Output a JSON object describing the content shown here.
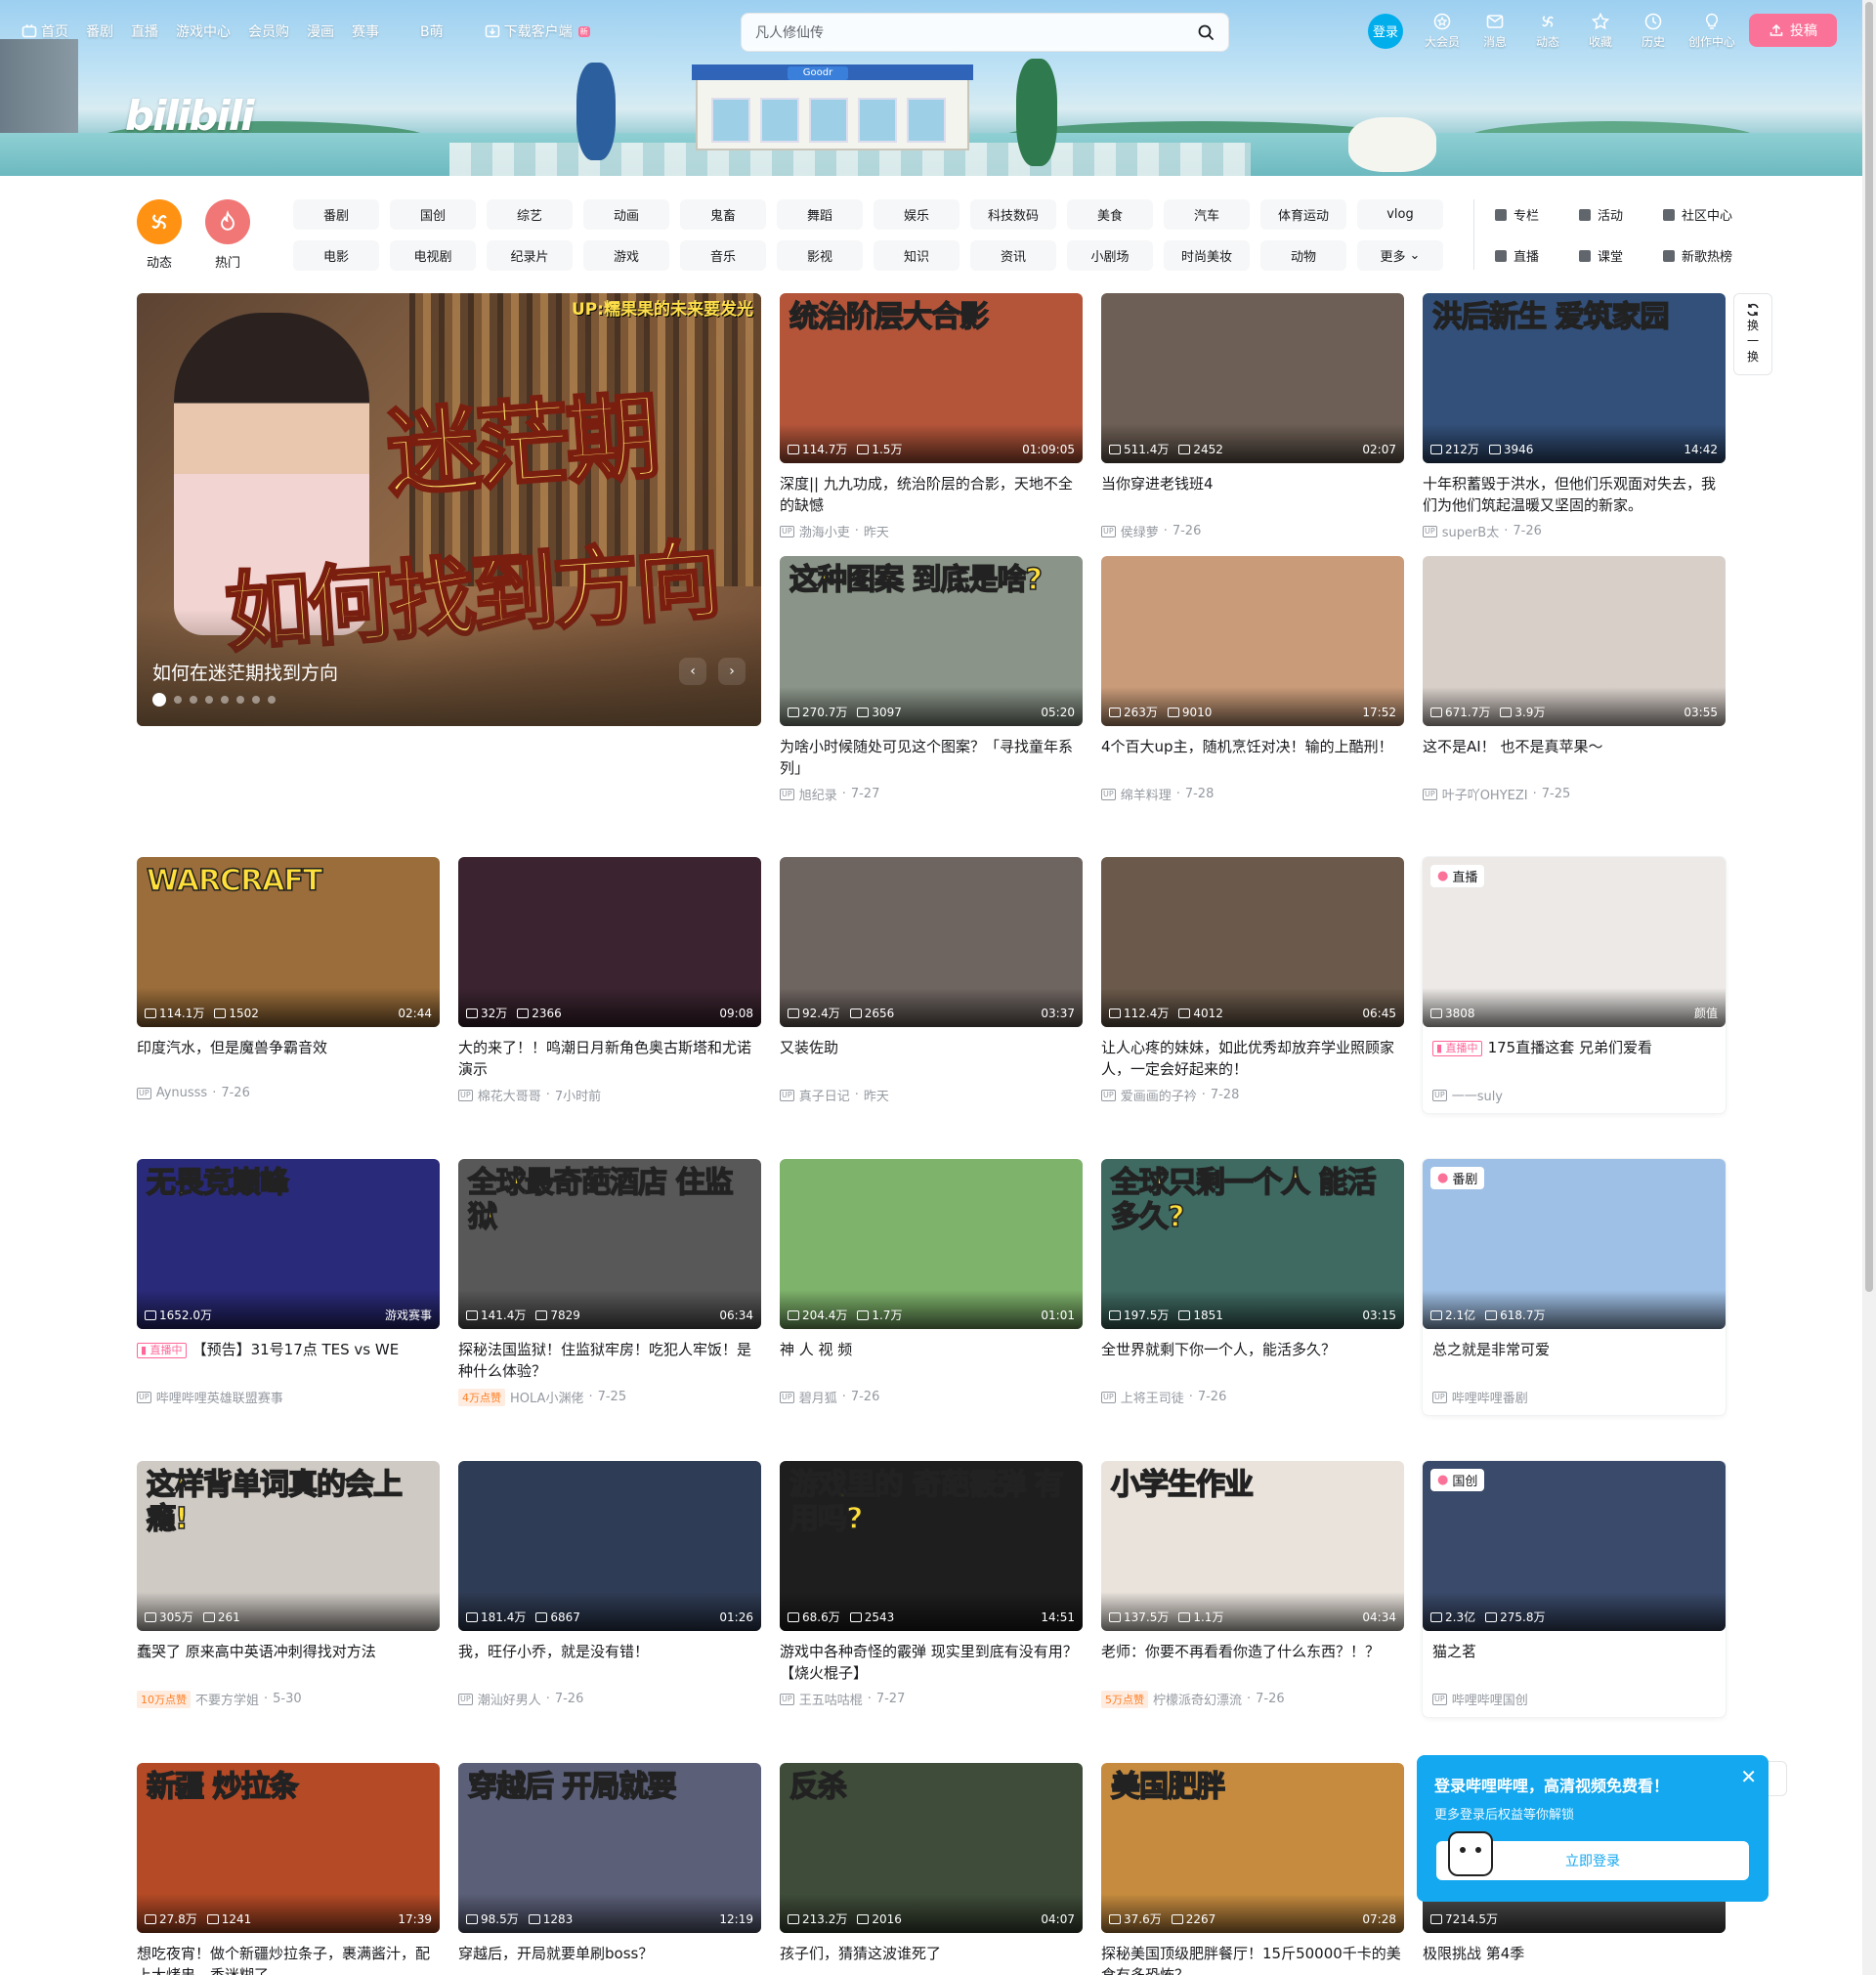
{
  "nav": {
    "left": [
      {
        "label": "首页",
        "icon": "tv-icon"
      },
      {
        "label": "番剧"
      },
      {
        "label": "直播"
      },
      {
        "label": "游戏中心"
      },
      {
        "label": "会员购"
      },
      {
        "label": "漫画"
      },
      {
        "label": "赛事"
      },
      {
        "label": "B萌"
      },
      {
        "label": "下载客户端",
        "icon": "download-icon",
        "badge": "新"
      }
    ],
    "search_placeholder": "凡人修仙传",
    "login": "登录",
    "right": [
      {
        "label": "大会员",
        "icon": "vip-icon"
      },
      {
        "label": "消息",
        "icon": "message-icon"
      },
      {
        "label": "动态",
        "icon": "wind-icon"
      },
      {
        "label": "收藏",
        "icon": "star-icon"
      },
      {
        "label": "历史",
        "icon": "clock-icon"
      },
      {
        "label": "创作中心",
        "icon": "bulb-icon"
      }
    ],
    "upload": "投稿"
  },
  "categories": {
    "big": [
      {
        "label": "动态",
        "color": "#ff9212"
      },
      {
        "label": "热门",
        "color": "#f07775"
      }
    ],
    "row1": [
      "番剧",
      "国创",
      "综艺",
      "动画",
      "鬼畜",
      "舞蹈",
      "娱乐",
      "科技数码",
      "美食",
      "汽车",
      "体育运动",
      "vlog"
    ],
    "row2": [
      "电影",
      "电视剧",
      "纪录片",
      "游戏",
      "音乐",
      "影视",
      "知识",
      "资讯",
      "小剧场",
      "时尚美妆",
      "动物",
      "更多"
    ],
    "side": [
      "专栏",
      "活动",
      "社区中心",
      "直播",
      "课堂",
      "新歌热榜"
    ]
  },
  "carousel": {
    "tag": "UP:糯果果的未来要发光",
    "text1": "迷茫期",
    "text2": "如何找到方向",
    "caption": "如何在迷茫期找到方向",
    "dots": 8
  },
  "refresh": {
    "label1": "换",
    "label2": "一",
    "label3": "换"
  },
  "cards": [
    {
      "hl": "统治阶层大合影",
      "views": "114.7万",
      "danmaku": "1.5万",
      "dur": "01:09:05",
      "title": "深度|| 九九功成，统治阶层的合影，天地不全的缺憾",
      "author": "渤海小吏",
      "date": "昨天",
      "bg": "#b4553a"
    },
    {
      "hl": "",
      "views": "511.4万",
      "danmaku": "2452",
      "dur": "02:07",
      "title": "当你穿进老钱班4",
      "author": "侯绿萝",
      "date": "7-26",
      "bg": "#6d5f55"
    },
    {
      "hl": "洪后新生 爱筑家园",
      "views": "212万",
      "danmaku": "3946",
      "dur": "14:42",
      "title": "十年积蓄毁于洪水，但他们乐观面对失去，我们为他们筑起温暖又坚固的新家。",
      "author": "superB太",
      "date": "7-26",
      "bg": "#33507a"
    },
    {
      "hl": "这种图案 到底是啥?",
      "views": "270.7万",
      "danmaku": "3097",
      "dur": "05:20",
      "title": "为啥小时候随处可见这个图案？「寻找童年系列」",
      "author": "旭纪录",
      "date": "7-27",
      "bg": "#8a9488"
    },
    {
      "hl": "",
      "views": "263万",
      "danmaku": "9010",
      "dur": "17:52",
      "title": "4个百大up主，随机烹饪对决！输的上酷刑！",
      "author": "绵羊料理",
      "date": "7-28",
      "bg": "#c99b79"
    },
    {
      "hl": "",
      "views": "671.7万",
      "danmaku": "3.9万",
      "dur": "03:55",
      "title": "这不是AI！ 也不是真苹果～",
      "author": "叶子吖OHYEZI",
      "date": "7-25",
      "bg": "#d8cfc9"
    },
    {
      "hl": "WARCRAFT",
      "views": "114.1万",
      "danmaku": "1502",
      "dur": "02:44",
      "title": "印度汽水，但是魔兽争霸音效",
      "author": "Aynusss",
      "date": "7-26",
      "bg": "#9a6d3a"
    },
    {
      "hl": "",
      "views": "32万",
      "danmaku": "2366",
      "dur": "09:08",
      "title": "大的来了！！鸣潮日月新角色奥古斯塔和尤诺演示",
      "author": "棉花大哥哥",
      "date": "7小时前",
      "bg": "#3b2430"
    },
    {
      "hl": "",
      "views": "92.4万",
      "danmaku": "2656",
      "dur": "03:37",
      "title": "又装佐助",
      "author": "真子日记",
      "date": "昨天",
      "bg": "#6e6460"
    },
    {
      "hl": "",
      "views": "112.4万",
      "danmaku": "4012",
      "dur": "06:45",
      "title": "让人心疼的妹妹，如此优秀却放弃学业照顾家人，一定会好起来的！",
      "author": "爱画画的子衿",
      "date": "7-28",
      "bg": "#6b5a4b"
    },
    {
      "hl": "",
      "live": true,
      "tag": "直播",
      "views": "3808",
      "dur": "颜值",
      "title": "175直播这套 兄弟们爱看",
      "author": "一一suly",
      "date": "",
      "bg": "#ece9e6",
      "boxed": true
    },
    {
      "hl": "无畏竞巅峰",
      "views": "1652.0万",
      "danmaku": "",
      "dur": "游戏赛事",
      "title": "【预告】31号17点 TES vs WE",
      "author": "哔哩哔哩英雄联盟赛事",
      "date": "",
      "bg": "#2a2a7a",
      "live": true
    },
    {
      "hl": "全球最奇葩酒店 住监狱",
      "views": "141.4万",
      "danmaku": "7829",
      "dur": "06:34",
      "title": "探秘法国监狱！住监狱牢房！吃犯人牢饭！是种什么体验？",
      "author": "HOLA小渊佬",
      "date": "7-25",
      "bg": "#585858",
      "hot": "4万点赞"
    },
    {
      "hl": "",
      "views": "204.4万",
      "danmaku": "1.7万",
      "dur": "01:01",
      "title": "神 人 视 频",
      "author": "碧月狐",
      "date": "7-26",
      "bg": "#7eb36b"
    },
    {
      "hl": "全球只剩一个人 能活多久?",
      "views": "197.5万",
      "danmaku": "1851",
      "dur": "03:15",
      "title": "全世界就剩下你一个人，能活多久？",
      "author": "上将王司徒",
      "date": "7-26",
      "bg": "#3f6a62"
    },
    {
      "hl": "",
      "tag": "番剧",
      "views": "2.1亿",
      "danmaku": "618.7万",
      "dur": "",
      "title": "总之就是非常可爱",
      "author": "哔哩哔哩番剧",
      "date": "",
      "bg": "#9fc0e6",
      "boxed": true
    },
    {
      "hl": "这样背单词真的会上瘾!",
      "views": "305万",
      "danmaku": "261",
      "dur": "",
      "title": "蠢哭了 原来高中英语冲刺得找对方法",
      "author": "不要方学姐",
      "date": "5-30",
      "bg": "#cfcac4",
      "hot": "10万点赞"
    },
    {
      "hl": "",
      "views": "181.4万",
      "danmaku": "6867",
      "dur": "01:26",
      "title": "我，旺仔小乔，就是没有错！",
      "author": "潮汕好男人",
      "date": "7-26",
      "bg": "#2f3c55"
    },
    {
      "hl": "游戏里的 奇葩霰弹 有用吗?",
      "views": "68.6万",
      "danmaku": "2543",
      "dur": "14:51",
      "title": "游戏中各种奇怪的霰弹 现实里到底有没有用？【烧火棍子】",
      "author": "王五咕咕棍",
      "date": "7-27",
      "bg": "#1e1e1e"
    },
    {
      "hl": "小学生作业",
      "views": "137.5万",
      "danmaku": "1.1万",
      "dur": "04:34",
      "title": "老师：你要不再看看你造了什么东西？！？",
      "author": "柠檬派奇幻漂流",
      "date": "7-26",
      "bg": "#e9e3dc",
      "hot": "5万点赞"
    },
    {
      "hl": "",
      "tag": "国创",
      "views": "2.3亿",
      "danmaku": "275.8万",
      "dur": "",
      "title": "猫之茗",
      "author": "哔哩哔哩国创",
      "date": "",
      "bg": "#3a4a6a",
      "boxed": true
    },
    {
      "hl": "新疆 炒拉条",
      "views": "27.8万",
      "danmaku": "1241",
      "dur": "17:39",
      "title": "想吃夜宵！做个新疆炒拉条子，裹满酱汁，配上大烤串，香迷糊了",
      "author": "",
      "date": "",
      "bg": "#b54a26"
    },
    {
      "hl": "穿越后 开局就要",
      "views": "98.5万",
      "danmaku": "1283",
      "dur": "12:19",
      "title": "穿越后，开局就要单刷boss？",
      "author": "",
      "date": "",
      "bg": "#5b5f78"
    },
    {
      "hl": "反杀",
      "views": "213.2万",
      "danmaku": "2016",
      "dur": "04:07",
      "title": "孩子们，猜猜这波谁死了",
      "author": "",
      "date": "",
      "bg": "#3f4c3a"
    },
    {
      "hl": "美国肥胖",
      "views": "37.6万",
      "danmaku": "2267",
      "dur": "07:28",
      "title": "探秘美国顶级肥胖餐厅！15斤50000千卡的美食有多恐怖？",
      "author": "",
      "date": "",
      "bg": "#c68b3f"
    },
    {
      "hl": "",
      "views": "7214.5万",
      "danmaku": "",
      "dur": "",
      "title": "极限挑战 第4季",
      "author": "",
      "date": "",
      "bg": "#4a4a4a"
    }
  ],
  "popup": {
    "title": "登录哔哩哔哩，高清视频免费看！",
    "sub": "更多登录后权益等你解锁",
    "btn": "立即登录"
  },
  "colors": {
    "pink": "#fb7299",
    "blue": "#00aeec",
    "text": "#18191c",
    "gray": "#9499a0"
  }
}
